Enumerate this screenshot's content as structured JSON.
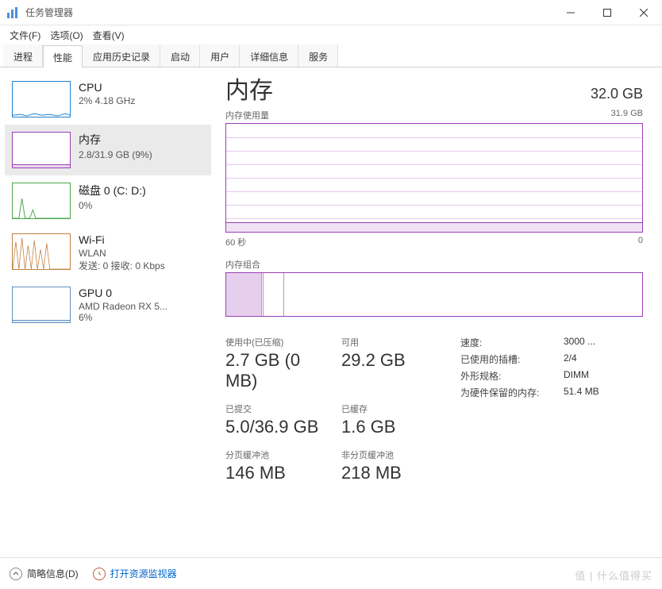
{
  "window": {
    "title": "任务管理器",
    "controls": {
      "min": "–",
      "max": "▢",
      "close": "✕"
    }
  },
  "menu": [
    "文件(F)",
    "选项(O)",
    "查看(V)"
  ],
  "tabs": [
    "进程",
    "性能",
    "应用历史记录",
    "启动",
    "用户",
    "详细信息",
    "服务"
  ],
  "active_tab": 1,
  "sidebar": [
    {
      "title": "CPU",
      "sub": "2% 4.18 GHz",
      "kind": "cpu"
    },
    {
      "title": "内存",
      "sub": "2.8/31.9 GB (9%)",
      "kind": "mem",
      "active": true
    },
    {
      "title": "磁盘 0 (C: D:)",
      "sub": "0%",
      "kind": "disk"
    },
    {
      "title": "Wi-Fi",
      "sub": "WLAN",
      "sub2": "发送: 0 接收: 0 Kbps",
      "kind": "wifi"
    },
    {
      "title": "GPU 0",
      "sub": "AMD Radeon RX 5...",
      "sub2": "6%",
      "kind": "gpu"
    }
  ],
  "main": {
    "title": "内存",
    "total": "32.0 GB",
    "usage_label": "内存使用量",
    "usage_max": "31.9 GB",
    "axis_left": "60 秒",
    "axis_right": "0",
    "composition_label": "内存组合",
    "stats": {
      "in_use": {
        "label": "使用中(已压缩)",
        "value": "2.7 GB (0 MB)"
      },
      "available": {
        "label": "可用",
        "value": "29.2 GB"
      },
      "committed": {
        "label": "已提交",
        "value": "5.0/36.9 GB"
      },
      "cached": {
        "label": "已缓存",
        "value": "1.6 GB"
      },
      "paged": {
        "label": "分页缓冲池",
        "value": "146 MB"
      },
      "nonpaged": {
        "label": "非分页缓冲池",
        "value": "218 MB"
      }
    },
    "details": {
      "speed": {
        "k": "速度:",
        "v": "3000 ..."
      },
      "slots": {
        "k": "已使用的插槽:",
        "v": "2/4"
      },
      "form": {
        "k": "外形规格:",
        "v": "DIMM"
      },
      "reserved": {
        "k": "为硬件保留的内存:",
        "v": "51.4 MB"
      }
    }
  },
  "footer": {
    "less": "简略信息(D)",
    "resmon": "打开资源监视器"
  },
  "watermark": "值 | 什么值得买",
  "chart_data": {
    "type": "area",
    "title": "内存使用量",
    "ylabel": "GB",
    "ylim": [
      0,
      31.9
    ],
    "xlabel": "秒",
    "xlim": [
      60,
      0
    ],
    "series": [
      {
        "name": "内存使用量",
        "values": [
          2.8,
          2.8,
          2.8,
          2.8,
          2.8,
          2.8,
          2.8,
          2.8,
          2.8,
          2.8,
          2.8,
          2.8
        ]
      }
    ],
    "composition": {
      "in_use_gb": 2.7,
      "modified_gb": 0.1,
      "standby_gb": 1.6,
      "free_gb": 27.5,
      "total_gb": 31.9
    }
  }
}
